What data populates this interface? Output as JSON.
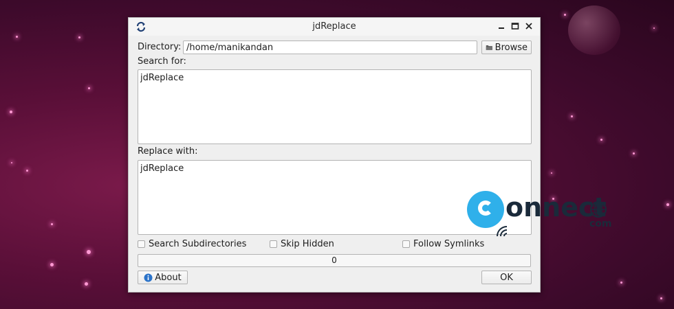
{
  "window": {
    "title": "jdReplace"
  },
  "directory": {
    "label": "Directory:",
    "value": "/home/manikandan",
    "browse_label": "Browse"
  },
  "search": {
    "label": "Search for:",
    "value": "jdReplace"
  },
  "replace": {
    "label": "Replace with:",
    "value": "jdReplace"
  },
  "options": [
    {
      "label": "Search Subdirectories",
      "checked": false
    },
    {
      "label": "Skip Hidden",
      "checked": false
    },
    {
      "label": "Follow Symlinks",
      "checked": false
    }
  ],
  "progress": {
    "text": "0",
    "fraction": 0
  },
  "buttons": {
    "about_label": "About",
    "ok_label": "OK"
  },
  "watermark": {
    "brand": "onnect",
    "suffix": "com"
  },
  "colors": {
    "accent": "#2fb0ea",
    "desktop": "#5a0f38"
  }
}
